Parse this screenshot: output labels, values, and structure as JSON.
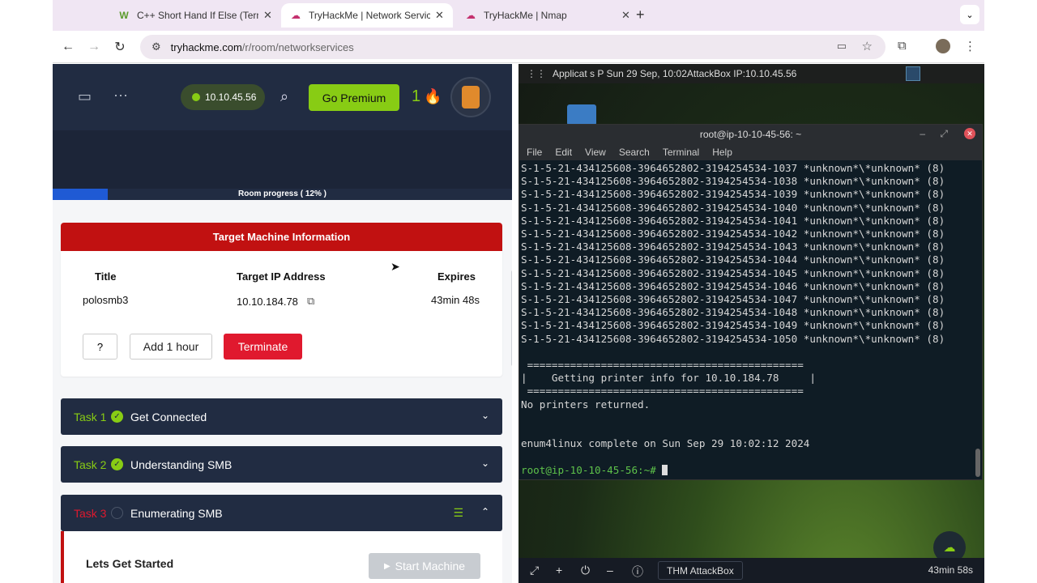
{
  "tabs": [
    {
      "title": "C++ Short Hand If Else (Terna",
      "favicon": "W",
      "close": "✕",
      "active": false
    },
    {
      "title": "TryHackMe | Network Service",
      "favicon": "☁",
      "close": "✕",
      "active": true
    },
    {
      "title": "TryHackMe | Nmap",
      "favicon": "☁",
      "close": "✕",
      "active": false
    }
  ],
  "address": {
    "host": "tryhackme.com",
    "path": "/r/room/networkservices"
  },
  "thm": {
    "ip": "10.10.45.56",
    "go_premium": "Go Premium",
    "streak": "1",
    "progress_label": "Room progress ( 12% )",
    "progress_fraction": 0.12
  },
  "target_machine": {
    "heading": "Target Machine Information",
    "col_title": "Title",
    "col_ip": "Target IP Address",
    "col_expires": "Expires",
    "title": "polosmb3",
    "ip": "10.10.184.78",
    "expires": "43min 48s",
    "help": "?",
    "add_hour": "Add 1 hour",
    "terminate": "Terminate"
  },
  "tasks": [
    {
      "num": "Task 1",
      "name": "Get Connected",
      "done": true
    },
    {
      "num": "Task 2",
      "name": "Understanding SMB",
      "done": true
    },
    {
      "num": "Task 3",
      "name": "Enumerating SMB",
      "done": false
    }
  ],
  "task3": {
    "intro": "Lets Get Started",
    "start_machine": "Start Machine"
  },
  "desktop": {
    "topbar": "Applicat  s  P  Sun 29 Sep, 10:02AttackBox IP:10.10.45.56",
    "terminal_title": "root@ip-10-10-45-56: ~",
    "menu": [
      "File",
      "Edit",
      "View",
      "Search",
      "Terminal",
      "Help"
    ],
    "lines": [
      "S-1-5-21-434125608-3964652802-3194254534-1037 *unknown*\\*unknown* (8)",
      "S-1-5-21-434125608-3964652802-3194254534-1038 *unknown*\\*unknown* (8)",
      "S-1-5-21-434125608-3964652802-3194254534-1039 *unknown*\\*unknown* (8)",
      "S-1-5-21-434125608-3964652802-3194254534-1040 *unknown*\\*unknown* (8)",
      "S-1-5-21-434125608-3964652802-3194254534-1041 *unknown*\\*unknown* (8)",
      "S-1-5-21-434125608-3964652802-3194254534-1042 *unknown*\\*unknown* (8)",
      "S-1-5-21-434125608-3964652802-3194254534-1043 *unknown*\\*unknown* (8)",
      "S-1-5-21-434125608-3964652802-3194254534-1044 *unknown*\\*unknown* (8)",
      "S-1-5-21-434125608-3964652802-3194254534-1045 *unknown*\\*unknown* (8)",
      "S-1-5-21-434125608-3964652802-3194254534-1046 *unknown*\\*unknown* (8)",
      "S-1-5-21-434125608-3964652802-3194254534-1047 *unknown*\\*unknown* (8)",
      "S-1-5-21-434125608-3964652802-3194254534-1048 *unknown*\\*unknown* (8)",
      "S-1-5-21-434125608-3964652802-3194254534-1049 *unknown*\\*unknown* (8)",
      "S-1-5-21-434125608-3964652802-3194254534-1050 *unknown*\\*unknown* (8)",
      "",
      " =============================================",
      "|    Getting printer info for 10.10.184.78     |",
      " =============================================",
      "No printers returned.",
      "",
      "",
      "enum4linux complete on Sun Sep 29 10:02:12 2024",
      ""
    ],
    "prompt": "root@ip-10-10-45-56:~# ",
    "attackbox_label": "THM AttackBox",
    "timer": "43min 58s"
  }
}
